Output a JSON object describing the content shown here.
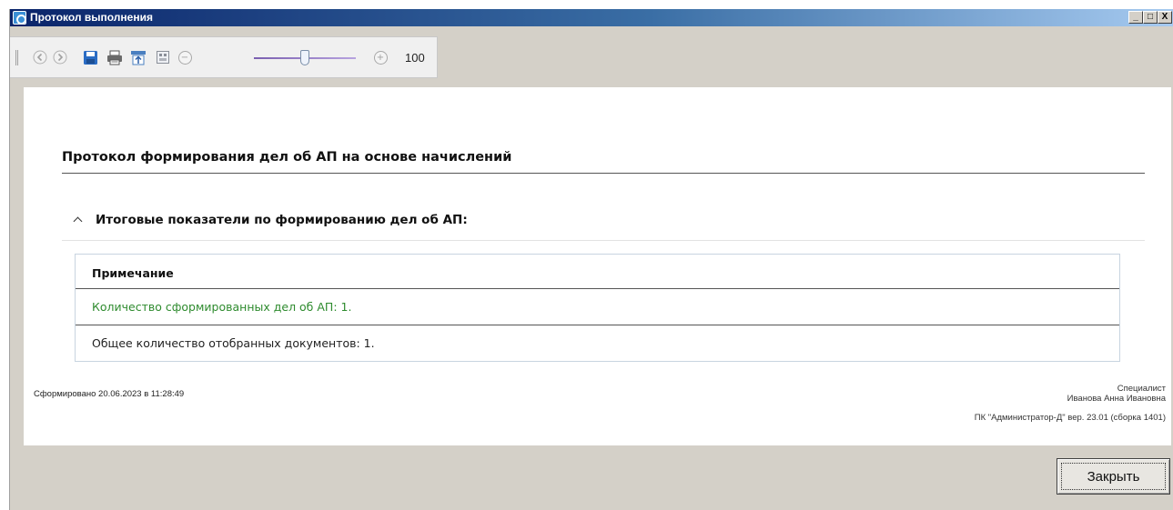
{
  "window": {
    "title": "Протокол выполнения",
    "controls": {
      "minimize": "_",
      "maximize": "□",
      "close": "X"
    }
  },
  "toolbar": {
    "icons": [
      "back-icon",
      "forward-icon",
      "save-icon",
      "print-icon",
      "export-icon",
      "page-layout-icon",
      "zoom-out-icon",
      "zoom-in-icon"
    ],
    "zoom_out_symbol": "−",
    "zoom_in_symbol": "+",
    "zoom_value": "100",
    "zoom_slider_level": 0.5
  },
  "report": {
    "title": "Протокол формирования дел об АП на основе начислений",
    "section_title": "Итоговые показатели по формированию дел об АП:",
    "table": {
      "header": "Примечание",
      "rows": [
        {
          "text": "Количество сформированных дел об АП: 1.",
          "color": "#2e8b2e"
        },
        {
          "text": "Общее количество отобранных документов: 1.",
          "color": "#222222"
        }
      ]
    },
    "footer": {
      "generated": "Сформировано 20.06.2023 в 11:28:49",
      "role": "Специалист",
      "person": "Иванова Анна Ивановна",
      "version": "ПК \"Администратор-Д\" вер. 23.01 (сборка 1401)"
    }
  },
  "buttons": {
    "close_label": "Закрыть"
  },
  "colors": {
    "title_bar": "#0a246a",
    "window_bg": "#d4d0c8",
    "success_text": "#2e8b2e"
  }
}
